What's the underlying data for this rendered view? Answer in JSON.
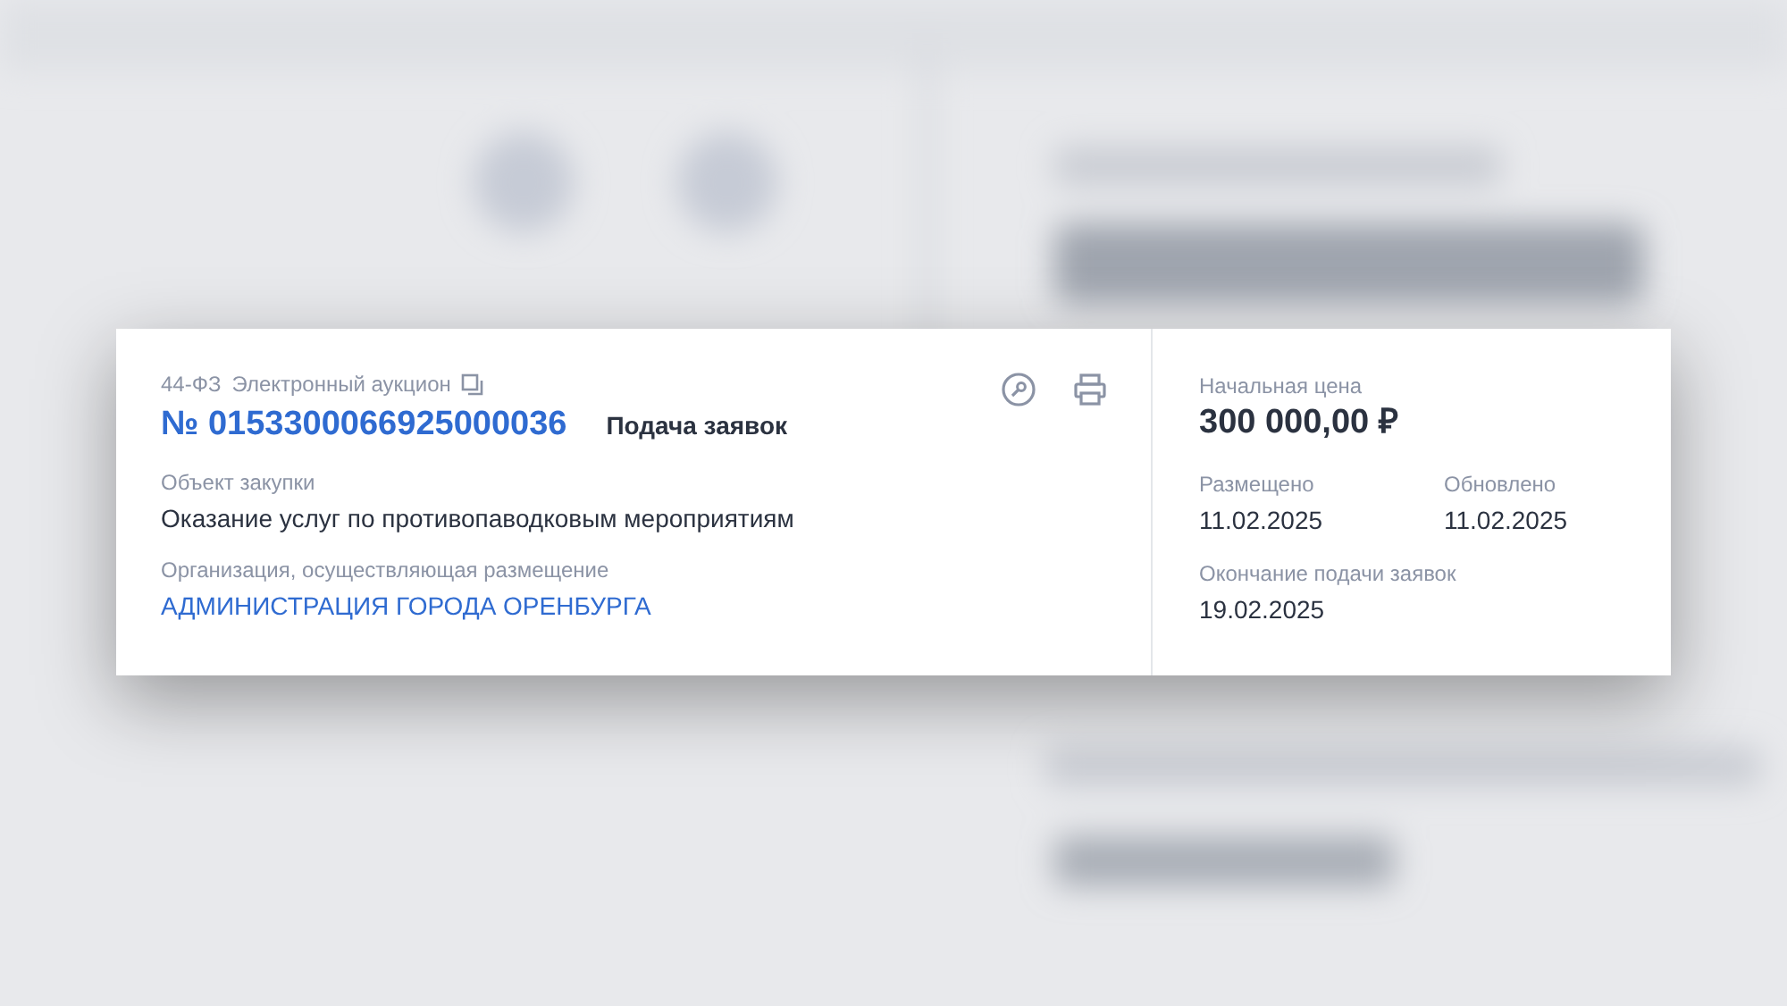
{
  "card": {
    "law": "44-ФЗ",
    "procedure": "Электронный аукцион",
    "number": "№ 0153300066925000036",
    "status": "Подача заявок",
    "fields": [
      {
        "label": "Объект закупки",
        "value": "Оказание услуг по противопаводковым мероприятиям",
        "kind": "text"
      },
      {
        "label": "Организация, осуществляющая размещение",
        "value": "АДМИНИСТРАЦИЯ ГОРОДА ОРЕНБУРГА",
        "kind": "link"
      }
    ],
    "price": {
      "label": "Начальная цена",
      "value": "300 000,00 ₽"
    },
    "dates": [
      {
        "label": "Размещено",
        "value": "11.02.2025"
      },
      {
        "label": "Обновлено",
        "value": "11.02.2025"
      },
      {
        "label": "Окончание подачи заявок",
        "value": "19.02.2025"
      }
    ]
  }
}
